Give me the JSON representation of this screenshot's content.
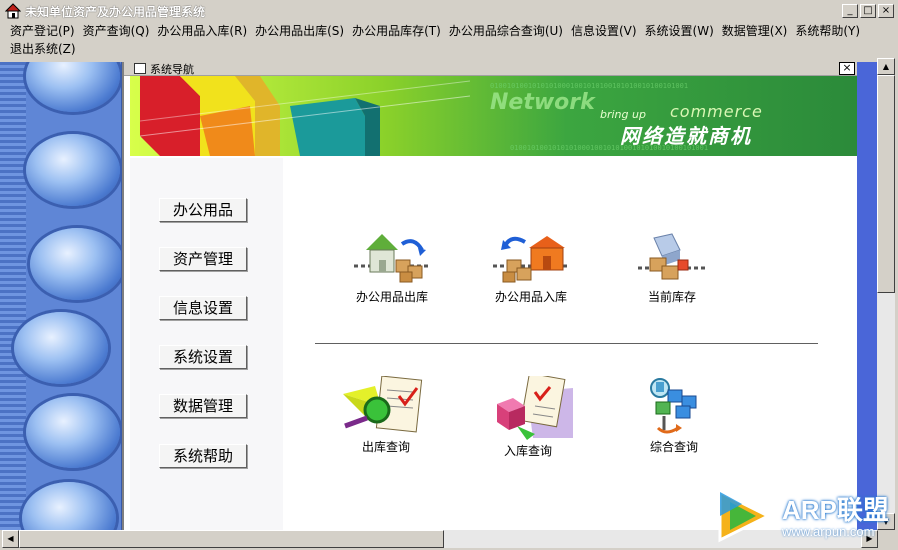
{
  "window": {
    "title": "未知单位资产及办公用品管理系统",
    "minimize_glyph": "_",
    "maximize_glyph": "□",
    "close_glyph": "×"
  },
  "menu": [
    {
      "label": "资产登记(P)"
    },
    {
      "label": "资产查询(Q)"
    },
    {
      "label": "办公用品入库(R)"
    },
    {
      "label": "办公用品出库(S)"
    },
    {
      "label": "办公用品库存(T)"
    },
    {
      "label": "办公用品综合查询(U)"
    },
    {
      "label": "信息设置(V)"
    },
    {
      "label": "系统设置(W)"
    },
    {
      "label": "数据管理(X)"
    },
    {
      "label": "系统帮助(Y)"
    },
    {
      "label": "退出系统(Z)"
    }
  ],
  "child_window": {
    "title": "系统导航",
    "close_glyph": "×"
  },
  "banner": {
    "network": "Network",
    "bring_up": "bring up",
    "commerce": "commerce",
    "slogan": "网络造就商机",
    "binary": "01001010010101010001001010100101010010100101001"
  },
  "nav_buttons": [
    {
      "label": "办公用品"
    },
    {
      "label": "资产管理"
    },
    {
      "label": "信息设置"
    },
    {
      "label": "系统设置"
    },
    {
      "label": "数据管理"
    },
    {
      "label": "系统帮助"
    }
  ],
  "tools_top": [
    {
      "label": "办公用品出库",
      "icon": "warehouse-out-icon"
    },
    {
      "label": "办公用品入库",
      "icon": "warehouse-in-icon"
    },
    {
      "label": "当前库存",
      "icon": "inventory-icon"
    }
  ],
  "tools_bottom": [
    {
      "label": "出库查询",
      "icon": "outbound-query-icon"
    },
    {
      "label": "入库查询",
      "icon": "inbound-query-icon"
    },
    {
      "label": "综合查询",
      "icon": "comprehensive-query-icon"
    }
  ],
  "watermark": {
    "brand": "ARP联盟",
    "url": "www.arpun.com"
  },
  "colors": {
    "rail": "#5f86d6",
    "banner_green": "#3ca640",
    "scroll_blue": "#4a66d8"
  }
}
